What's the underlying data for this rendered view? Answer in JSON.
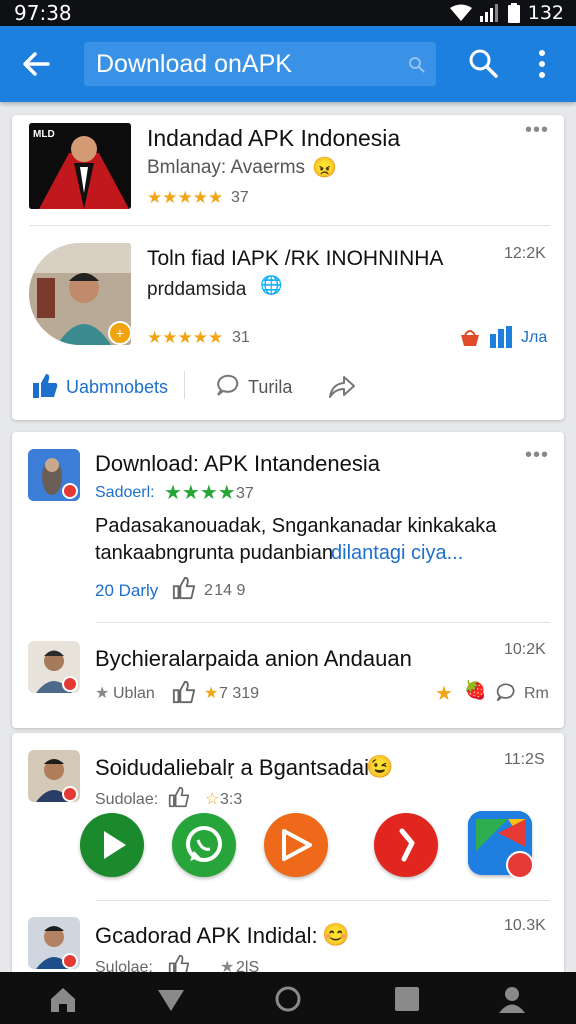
{
  "status": {
    "time": "97:38",
    "battery": "132"
  },
  "appbar": {
    "search_query": "Download onAPK"
  },
  "card1": {
    "item1": {
      "title": "Indandad APK Indonesia",
      "subtitle": "Bmlanay: Avaerms",
      "rating": "37"
    },
    "item2": {
      "title": "Toln fiad IAPK /RK INOHNINHA",
      "subtitle": "prddamsida",
      "size": "12:2K",
      "rating": "31",
      "right_label": "Jла"
    },
    "actions": {
      "like": "Uabmnobets",
      "comment": "Turila"
    }
  },
  "card2": {
    "post1": {
      "title": "Download: APK Intandenesia",
      "source": "Sadoerl:",
      "rating": "37",
      "body_line1": "Padasakanouadak, Sngankanadar kinkakaka",
      "body_line2_a": "tankaabngrunta pudanbian",
      "body_line2_b": "dilantagi ciya...",
      "days": "20 Darly",
      "likes": "2 14 9"
    },
    "post2": {
      "title": "Bychieralarpaida anion Andauan",
      "size": "10:2K",
      "tag": "Ublan",
      "likes": "7 319",
      "right_label": "Rm"
    }
  },
  "card3": {
    "post1": {
      "title": "Soidudaliebalṛ a Bgantsadai",
      "size": "11:2S",
      "source": "Sudolae:",
      "likes": "3:3"
    },
    "apps": [
      "play-store-icon",
      "whatsapp-icon",
      "video-player-icon",
      "music-icon",
      "google-play-icon"
    ],
    "post2": {
      "title": "Gcadorad APK Indidal:",
      "size": "10.3K",
      "source": "Sulolae:",
      "likes": "2lS"
    }
  },
  "colors": {
    "app_bar": "#1d7fde",
    "accent_star": "#f2a514",
    "green_star": "#27a53a",
    "link": "#1d6fce"
  }
}
